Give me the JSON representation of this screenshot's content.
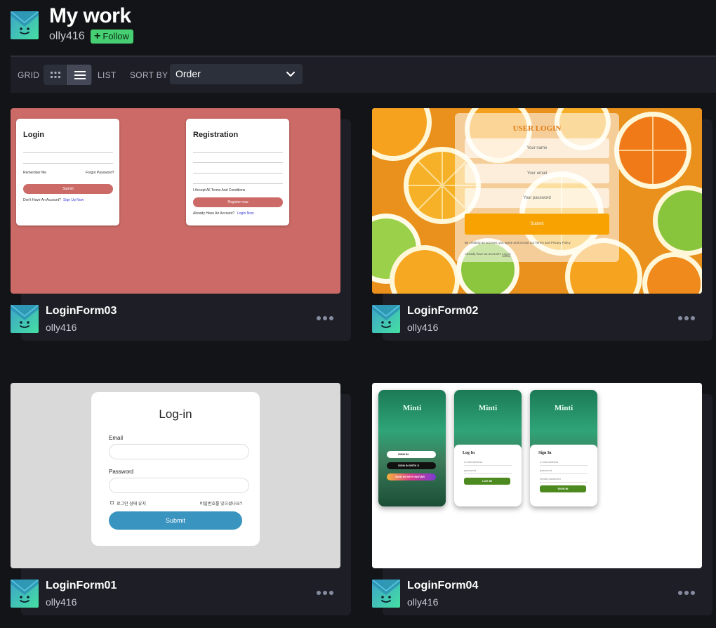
{
  "header": {
    "title": "My work",
    "username": "olly416",
    "follow_label": "Follow"
  },
  "toolbar": {
    "grid_label": "GRID",
    "list_label": "LIST",
    "sort_label": "SORT BY",
    "sort_value": "Order",
    "active_view": "list"
  },
  "colors": {
    "background": "#131417",
    "card": "#1e1f26",
    "follow_green": "#47cf73",
    "avatar_teal": "#3fd7a5"
  },
  "cards": [
    {
      "title": "LoginForm03",
      "owner": "olly416",
      "preview": {
        "background": "#cb6a66",
        "login_title": "Login",
        "remember": "Remember Me",
        "forgot": "Forgot Password?",
        "submit": "Submit",
        "no_account": "Don't Have An Account?",
        "signup_link": "Sign Up Now",
        "reg_title": "Registration",
        "terms": "I Accept All Terms And Conditions",
        "register_btn": "Register now",
        "have_account": "Already Have An Account?",
        "login_link": "Login Now"
      }
    },
    {
      "title": "LoginForm02",
      "owner": "olly416",
      "preview": {
        "heading": "USER LOGIN",
        "name_ph": "Your name",
        "email_ph": "Your email",
        "password_ph": "Your password",
        "submit": "Submit",
        "terms": "By creating an account, you agree and accept our Terms and Privacy Policy",
        "have_account": "Already have an account?",
        "login_link": "Log in"
      }
    },
    {
      "title": "LoginForm01",
      "owner": "olly416",
      "preview": {
        "heading": "Log-in",
        "email_label": "Email",
        "password_label": "Password",
        "keep_login": "로그인 상태 유지",
        "forgot": "비밀번호를 잊으셨나요?",
        "submit": "Submit"
      }
    },
    {
      "title": "LoginForm04",
      "owner": "olly416",
      "preview": {
        "brand": "Minti",
        "sign_in": "SIGN IN",
        "sign_in_x": "SIGN IN WITH X",
        "sign_in_insta": "SIGN IN WITH INSTAR",
        "login_title": "Log In",
        "email_ph": "e-mail address",
        "password_ph": "password",
        "repeat_ph": "repeat password",
        "login_btn": "LOG IN",
        "signin_title": "Sign In",
        "signin_btn": "SIGN IN"
      }
    }
  ]
}
